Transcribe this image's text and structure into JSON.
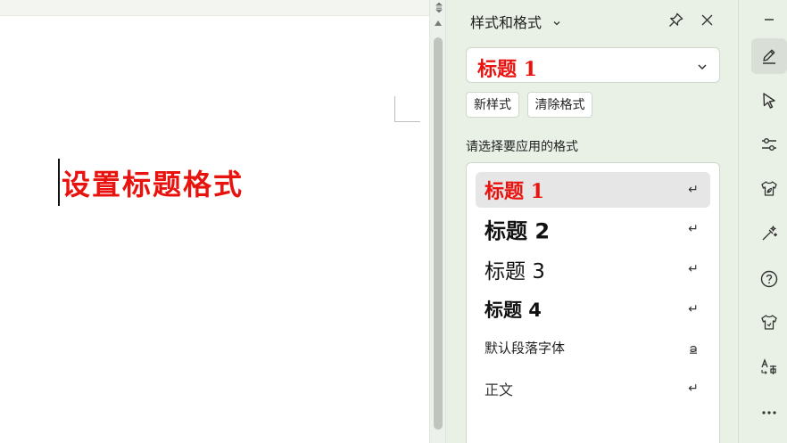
{
  "document": {
    "heading_text": "设置标题格式"
  },
  "panel": {
    "title": "样式和格式",
    "title_chevron_icon": "chevron-down-icon",
    "pin_icon": "pin-icon",
    "close_icon": "close-icon",
    "current_style": "标题 1",
    "new_style_label": "新样式",
    "clear_format_label": "清除格式",
    "section_label": "请选择要应用的格式",
    "styles": [
      {
        "label": "标题 1",
        "icon": "paragraph-mark-icon",
        "glyph": "↵",
        "selected": true
      },
      {
        "label": "标题 2",
        "icon": "paragraph-mark-icon",
        "glyph": "↵",
        "selected": false
      },
      {
        "label": "标题 3",
        "icon": "paragraph-mark-icon",
        "glyph": "↵",
        "selected": false
      },
      {
        "label": "标题 4",
        "icon": "paragraph-mark-icon",
        "glyph": "↵",
        "selected": false
      },
      {
        "label": "默认段落字体",
        "icon": "character-style-icon",
        "glyph": "a",
        "selected": false
      },
      {
        "label": "正文",
        "icon": "paragraph-mark-icon",
        "glyph": "↵",
        "selected": false
      }
    ]
  },
  "toolbar": {
    "items": [
      {
        "name": "minimize-icon"
      },
      {
        "name": "pen-icon",
        "active": true
      },
      {
        "name": "select-cursor-icon"
      },
      {
        "name": "adjust-sliders-icon"
      },
      {
        "name": "shirt-leaf-icon"
      },
      {
        "name": "magic-wand-icon"
      },
      {
        "name": "help-icon"
      },
      {
        "name": "shirt-icon"
      },
      {
        "name": "translate-icon"
      },
      {
        "name": "more-icon"
      }
    ]
  },
  "colors": {
    "heading_red": "#e8130f",
    "panel_bg": "#e9f0e6",
    "selected_bg": "#e6e6e6"
  }
}
